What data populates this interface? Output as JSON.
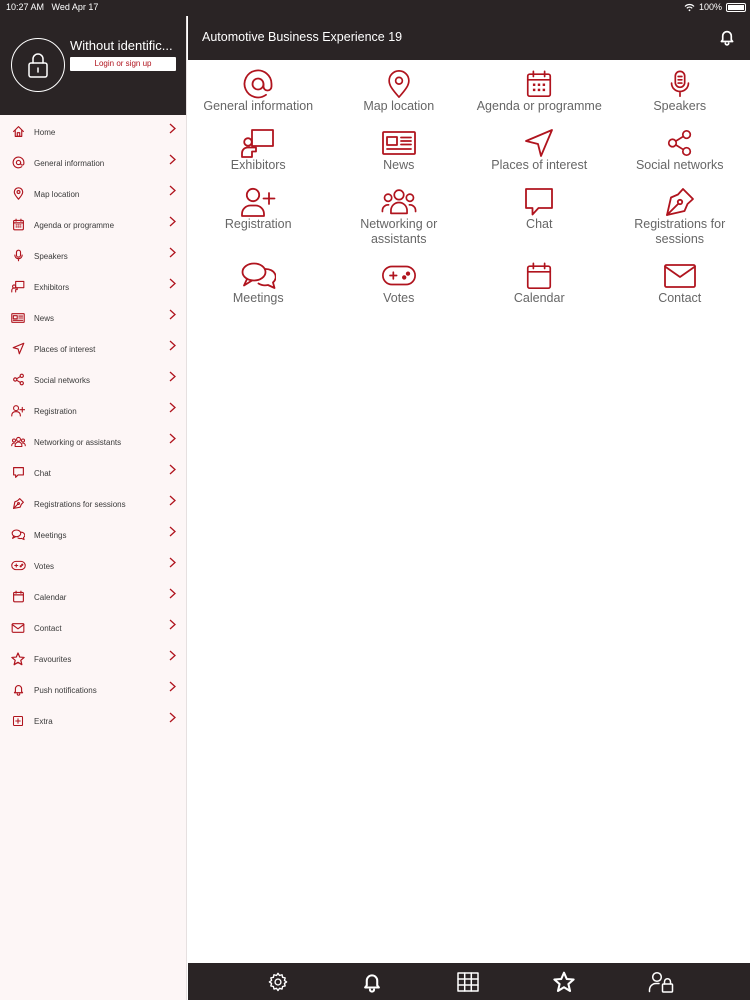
{
  "status_bar": {
    "time": "10:27 AM",
    "date": "Wed Apr 17",
    "battery": "100%"
  },
  "colors": {
    "accent": "#b0141e",
    "dark": "#2a2425",
    "sidebar_bg": "#fdf6f6"
  },
  "profile": {
    "name": "Without identific...",
    "login_label": "Login or sign up",
    "icon": "lock-icon"
  },
  "header": {
    "title": "Automotive Business Experience 19",
    "icon": "bell-icon"
  },
  "sidebar": {
    "items": [
      {
        "label": "Home",
        "icon": "home-icon"
      },
      {
        "label": "General information",
        "icon": "at-icon"
      },
      {
        "label": "Map location",
        "icon": "map-pin-icon"
      },
      {
        "label": "Agenda or programme",
        "icon": "agenda-icon"
      },
      {
        "label": "Speakers",
        "icon": "microphone-icon"
      },
      {
        "label": "Exhibitors",
        "icon": "presenter-icon"
      },
      {
        "label": "News",
        "icon": "newspaper-icon"
      },
      {
        "label": "Places of interest",
        "icon": "navigation-icon"
      },
      {
        "label": "Social networks",
        "icon": "share-icon"
      },
      {
        "label": "Registration",
        "icon": "user-plus-icon"
      },
      {
        "label": "Networking or assistants",
        "icon": "users-icon"
      },
      {
        "label": "Chat",
        "icon": "chat-icon"
      },
      {
        "label": "Registrations for sessions",
        "icon": "pen-nib-icon"
      },
      {
        "label": "Meetings",
        "icon": "meetings-icon"
      },
      {
        "label": "Votes",
        "icon": "gamepad-icon"
      },
      {
        "label": "Calendar",
        "icon": "calendar-icon"
      },
      {
        "label": "Contact",
        "icon": "envelope-icon"
      },
      {
        "label": "Favourites",
        "icon": "star-icon"
      },
      {
        "label": "Push notifications",
        "icon": "bell-icon"
      },
      {
        "label": "Extra",
        "icon": "plus-square-icon"
      }
    ]
  },
  "grid": {
    "tiles": [
      {
        "label": "General information",
        "icon": "at-icon"
      },
      {
        "label": "Map location",
        "icon": "map-pin-icon"
      },
      {
        "label": "Agenda or programme",
        "icon": "agenda-icon"
      },
      {
        "label": "Speakers",
        "icon": "microphone-icon"
      },
      {
        "label": "Exhibitors",
        "icon": "presenter-icon"
      },
      {
        "label": "News",
        "icon": "newspaper-icon"
      },
      {
        "label": "Places of interest",
        "icon": "navigation-icon"
      },
      {
        "label": "Social networks",
        "icon": "share-icon"
      },
      {
        "label": "Registration",
        "icon": "user-plus-icon"
      },
      {
        "label": "Networking or assistants",
        "icon": "users-icon"
      },
      {
        "label": "Chat",
        "icon": "chat-icon"
      },
      {
        "label": "Registrations for sessions",
        "icon": "pen-nib-icon"
      },
      {
        "label": "Meetings",
        "icon": "meetings-icon"
      },
      {
        "label": "Votes",
        "icon": "gamepad-icon"
      },
      {
        "label": "Calendar",
        "icon": "calendar-icon"
      },
      {
        "label": "Contact",
        "icon": "envelope-icon"
      }
    ]
  },
  "bottom_bar": {
    "items": [
      {
        "icon": "settings-icon"
      },
      {
        "icon": "bell-icon"
      },
      {
        "icon": "grid-icon"
      },
      {
        "icon": "star-icon"
      },
      {
        "icon": "user-lock-icon"
      }
    ]
  }
}
